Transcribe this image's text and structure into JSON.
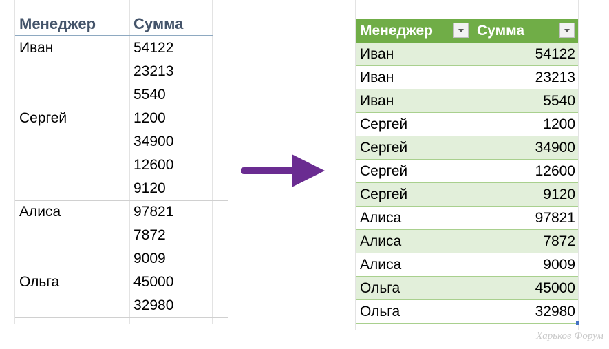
{
  "left_table": {
    "headers": {
      "manager": "Менеджер",
      "sum": "Сумма"
    },
    "groups": [
      {
        "manager": "Иван",
        "values": [
          "54122",
          "23213",
          "5540"
        ]
      },
      {
        "manager": "Сергей",
        "values": [
          "1200",
          "34900",
          "12600",
          "9120"
        ]
      },
      {
        "manager": "Алиса",
        "values": [
          "97821",
          "7872",
          "9009"
        ]
      },
      {
        "manager": "Ольга",
        "values": [
          "45000",
          "32980"
        ]
      }
    ]
  },
  "right_table": {
    "headers": {
      "manager": "Менеджер",
      "sum": "Сумма"
    },
    "header_color": "#70ad47",
    "band_color": "#e2efda",
    "rows": [
      {
        "manager": "Иван",
        "sum": "54122"
      },
      {
        "manager": "Иван",
        "sum": "23213"
      },
      {
        "manager": "Иван",
        "sum": "5540"
      },
      {
        "manager": "Сергей",
        "sum": "1200"
      },
      {
        "manager": "Сергей",
        "sum": "34900"
      },
      {
        "manager": "Сергей",
        "sum": "12600"
      },
      {
        "manager": "Сергей",
        "sum": "9120"
      },
      {
        "manager": "Алиса",
        "sum": "97821"
      },
      {
        "manager": "Алиса",
        "sum": "7872"
      },
      {
        "manager": "Алиса",
        "sum": "9009"
      },
      {
        "manager": "Ольга",
        "sum": "45000"
      },
      {
        "manager": "Ольга",
        "sum": "32980"
      }
    ]
  },
  "arrow": {
    "color": "#6a2c91",
    "icon": "right-arrow-icon"
  },
  "watermark": "Харьков Форум"
}
